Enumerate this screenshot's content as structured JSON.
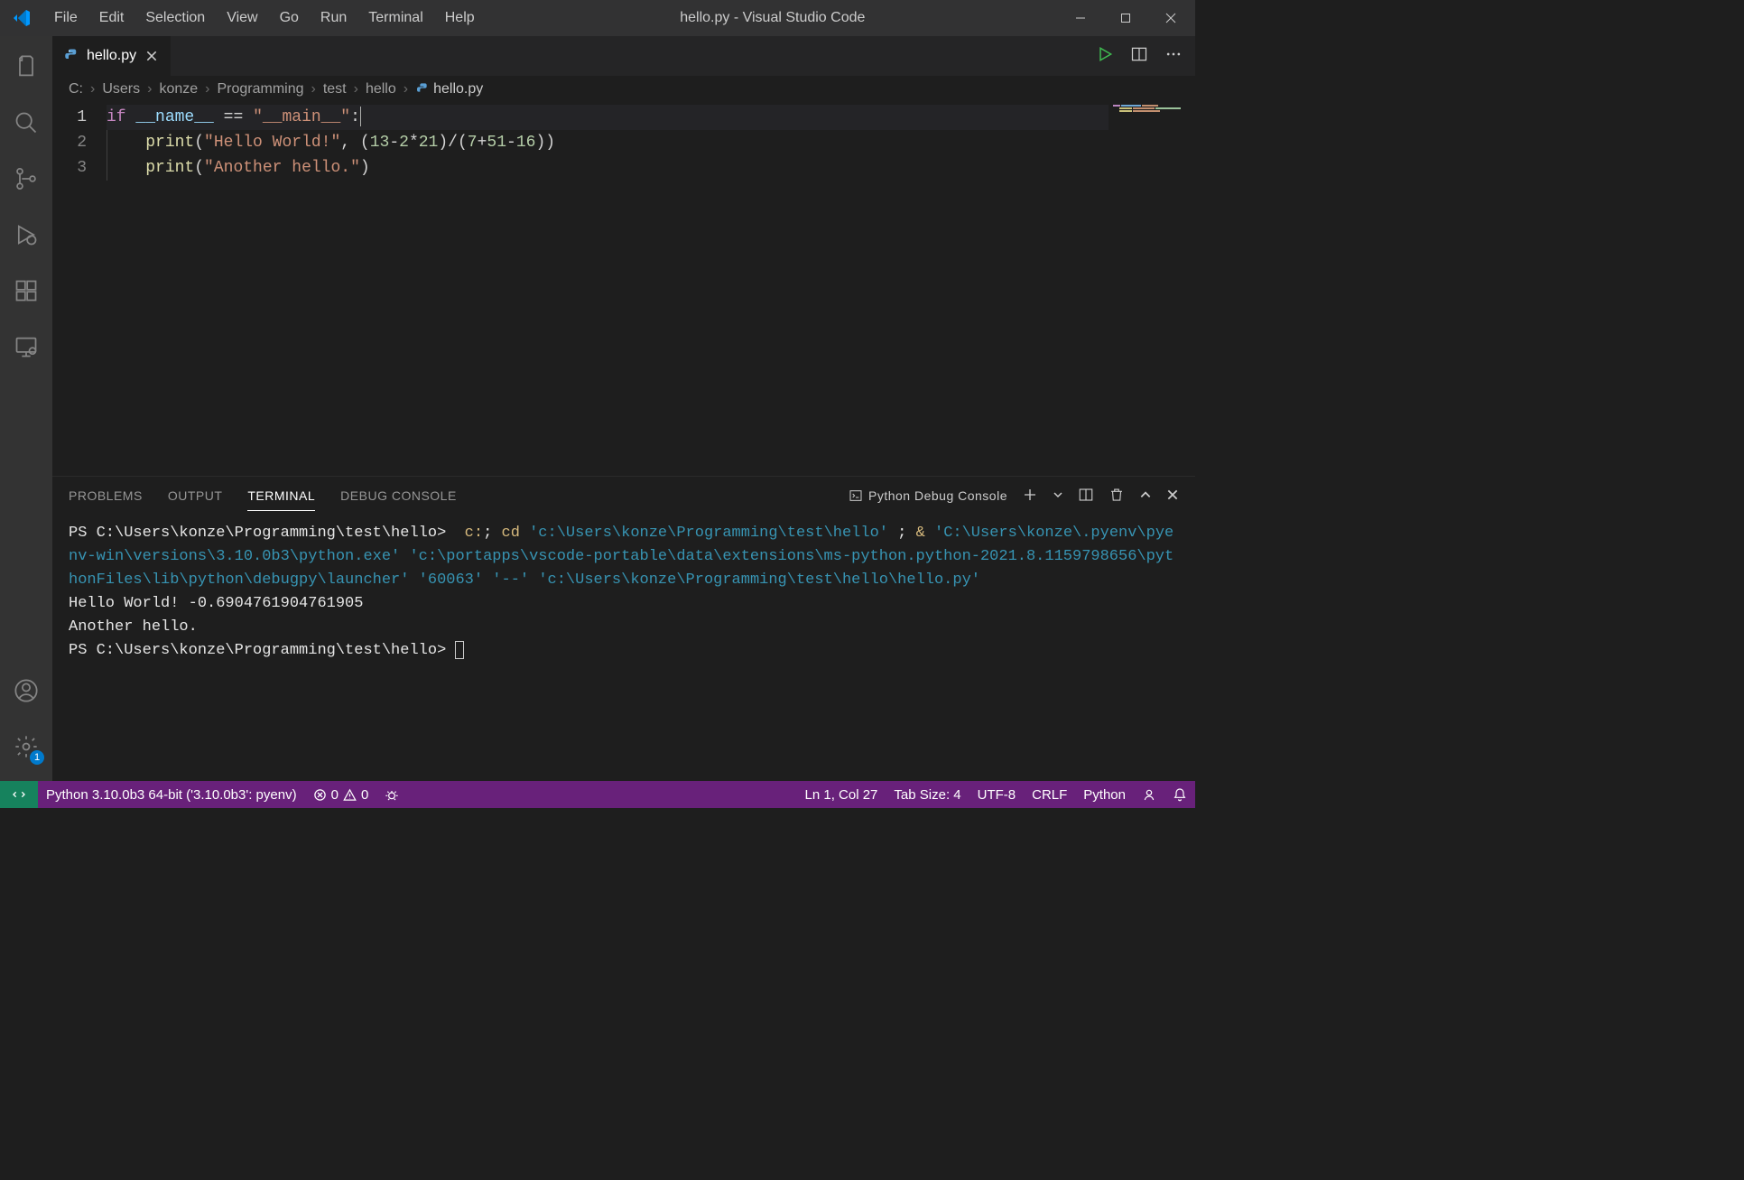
{
  "title": "hello.py - Visual Studio Code",
  "menu": [
    "File",
    "Edit",
    "Selection",
    "View",
    "Go",
    "Run",
    "Terminal",
    "Help"
  ],
  "tab": {
    "name": "hello.py"
  },
  "breadcrumb": [
    "C:",
    "Users",
    "konze",
    "Programming",
    "test",
    "hello",
    "hello.py"
  ],
  "code": {
    "line1": {
      "kw": "if",
      "var": "__name__",
      "op": " == ",
      "str": "\"__main__\"",
      "colon": ":"
    },
    "line2": {
      "fn": "print",
      "open": "(",
      "str": "\"Hello World!\"",
      "comma": ", ",
      "p1": "(",
      "n1": "13",
      "o1": "-",
      "n2": "2",
      "o2": "*",
      "n3": "21",
      "p2": ")",
      "o3": "/",
      "p3": "(",
      "n4": "7",
      "o4": "+",
      "n5": "51",
      "o5": "-",
      "n6": "16",
      "p4": "))"
    },
    "line3": {
      "fn": "print",
      "open": "(",
      "str": "\"Another hello.\"",
      "close": ")"
    }
  },
  "lineNumbers": [
    "1",
    "2",
    "3"
  ],
  "panel": {
    "tabs": [
      "PROBLEMS",
      "OUTPUT",
      "TERMINAL",
      "DEBUG CONSOLE"
    ],
    "dropdown": "Python Debug Console"
  },
  "terminal": {
    "prompt1": "PS C:\\Users\\konze\\Programming\\test\\hello> ",
    "cmd1a": " c:",
    "cmd1b": ";",
    "cmd1c": " cd ",
    "path1": "'c:\\Users\\konze\\Programming\\test\\hello'",
    "semi": " ; ",
    "amp": "& ",
    "pyexe": "'C:\\Users\\konze\\.pyenv\\pyenv-win\\versions\\3.10.0b3\\python.exe'",
    "sp": " ",
    "debugpy": "'c:\\portapps\\vscode-portable\\data\\extensions\\ms-python.python-2021.8.1159798656\\pythonFiles\\lib\\python\\debugpy\\launcher'",
    "port": "'60063'",
    "dashes": "'--'",
    "hello": "'c:\\Users\\konze\\Programming\\test\\hello\\hello.py'",
    "out1": "Hello World! -0.6904761904761905",
    "out2": "Another hello.",
    "prompt2": "PS C:\\Users\\konze\\Programming\\test\\hello> "
  },
  "status": {
    "python": "Python 3.10.0b3 64-bit ('3.10.0b3': pyenv)",
    "errors": "0",
    "warnings": "0",
    "cursor": "Ln 1, Col 27",
    "tabsize": "Tab Size: 4",
    "encoding": "UTF-8",
    "eol": "CRLF",
    "lang": "Python"
  },
  "badge": "1"
}
